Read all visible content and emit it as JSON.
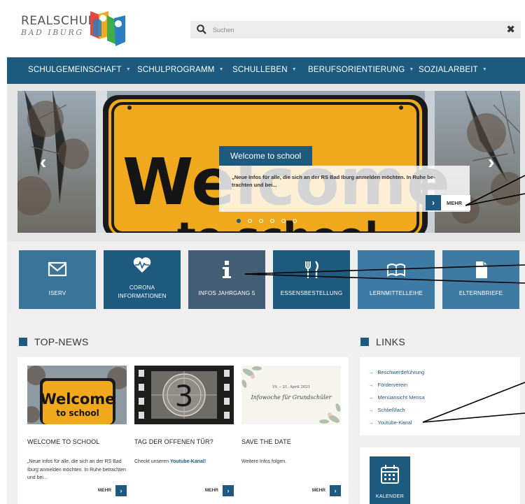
{
  "header": {
    "logo_line1": "REALSCHULE",
    "logo_line2": "BAD IBURG",
    "search_placeholder": "Suchen",
    "close_label": "✖"
  },
  "nav": {
    "items": [
      {
        "label": "SCHULGEMEINSCHAFT"
      },
      {
        "label": "SCHULPROGRAMM"
      },
      {
        "label": "SCHULLEBEN"
      },
      {
        "label": "BERUFSORIENTIERUNG"
      },
      {
        "label": "SOZIALARBEIT"
      }
    ]
  },
  "slider": {
    "sign_word1": "Welcome",
    "sign_word2": "to school",
    "caption_title": "Welcome to school",
    "caption_text": "„Neue Infos für alle, die sich an der RS Bad Iburg anmelden möchten. In Ruhe be- trachten und bei...",
    "more_label": "MEHR",
    "prev_label": "‹",
    "next_label": "›",
    "slide_count": 6,
    "active_slide": 1
  },
  "tiles": [
    {
      "label1": "ISERV",
      "label2": "",
      "icon": "mail-icon",
      "color": "#3a7499"
    },
    {
      "label1": "CORONA",
      "label2": "INFORMATIONEN",
      "icon": "heart-pulse-icon",
      "color": "#1d5a7e"
    },
    {
      "label1": "INFOS JAHRGANG 5",
      "label2": "",
      "icon": "info-icon",
      "color": "#435d75"
    },
    {
      "label1": "ESSENSBESTELLUNG",
      "label2": "",
      "icon": "cutlery-icon",
      "color": "#1d5a7e"
    },
    {
      "label1": "LERNMITTELLEIHE",
      "label2": "",
      "icon": "book-icon",
      "color": "#3d7ba4"
    },
    {
      "label1": "ELTERNBRIEFE",
      "label2": "",
      "icon": "document-icon",
      "color": "#3f7aa3"
    }
  ],
  "topnews": {
    "heading": "TOP-NEWS",
    "cards": [
      {
        "img_line1": "Welcome",
        "img_line2": "to school",
        "title": "WELCOME TO SCHOOL",
        "text": "„Neue Infos für alle, die sich an der RS Bad Iburg anmelden möchten. In Ruhe betrachten und bei...",
        "text_link": "",
        "more": "MEHR"
      },
      {
        "img_number": "3",
        "title": "TAG DER OFFENEN TÜR?",
        "text": "Checkt unseren ",
        "text_link": "Youtube-Kanal!",
        "more": "MEHR"
      },
      {
        "img_date": "19. – 21. April 2021",
        "img_script": "Infowoche für Grundschüler",
        "title": "SAVE THE DATE",
        "text": "Weitere Infos folgen.",
        "text_link": "",
        "more": "MEHR"
      }
    ]
  },
  "links": {
    "heading": "LINKS",
    "items": [
      {
        "label": "Beschwerdeführung"
      },
      {
        "label": "Förderverein"
      },
      {
        "label": "Menüansicht Mensa"
      },
      {
        "label": "Schließfach"
      },
      {
        "label": "Youtube-Kanal"
      }
    ],
    "arrow": "→"
  },
  "calendar": {
    "label": "KALENDER"
  },
  "colors": {
    "primary": "#1d5a7e",
    "sign_yellow": "#f0a81c"
  }
}
